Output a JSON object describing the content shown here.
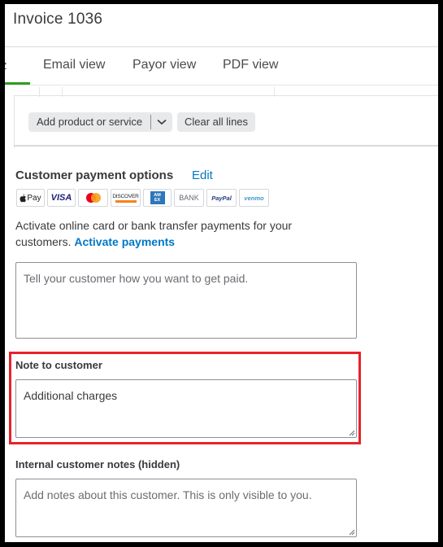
{
  "invoice": {
    "title": "Invoice 1036"
  },
  "tabs": [
    {
      "label": "Email view",
      "active": true
    },
    {
      "label": "Payor view",
      "active": false
    },
    {
      "label": "PDF view",
      "active": false
    }
  ],
  "edge_glyph": "z",
  "product_toolbar": {
    "add_label": "Add product or service",
    "caret_icon": "chevron-down-icon",
    "clear_label": "Clear all lines"
  },
  "payment_options": {
    "title": "Customer payment options",
    "edit_label": "Edit",
    "methods": [
      {
        "name": "apple-pay",
        "text": "Pay"
      },
      {
        "name": "visa",
        "text": "VISA"
      },
      {
        "name": "mastercard",
        "text": ""
      },
      {
        "name": "discover",
        "text": "DISCOVER"
      },
      {
        "name": "amex",
        "text": "AM EX"
      },
      {
        "name": "bank",
        "text": "BANK"
      },
      {
        "name": "paypal",
        "text": "PayPal"
      },
      {
        "name": "venmo",
        "text": "venmo"
      }
    ],
    "activate_text": "Activate online card or bank transfer payments for your customers.",
    "activate_link": "Activate payments",
    "message_placeholder": "Tell your customer how you want to get paid."
  },
  "note_to_customer": {
    "label": "Note to customer",
    "value": "Additional charges"
  },
  "internal_notes": {
    "label": "Internal customer notes (hidden)",
    "placeholder": "Add notes about this customer. This is only visible to you."
  },
  "colors": {
    "accent_green": "#2ca01c",
    "link_blue": "#0077c5",
    "highlight_red": "#e8222b"
  }
}
